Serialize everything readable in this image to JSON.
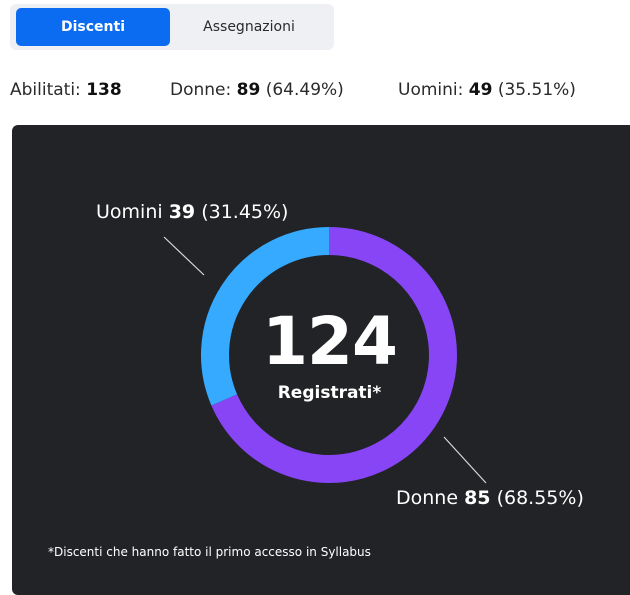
{
  "tabs": [
    {
      "label": "Discenti",
      "active": true
    },
    {
      "label": "Assegnazioni",
      "active": false
    }
  ],
  "stats": {
    "abilitati_label": "Abilitati:",
    "abilitati_value": "138",
    "donne_label": "Donne:",
    "donne_value": "89",
    "donne_pct": "(64.49%)",
    "uomini_label": "Uomini:",
    "uomini_value": "49",
    "uomini_pct": "(35.51%)"
  },
  "chart_data": {
    "type": "pie",
    "center_value": "124",
    "center_label": "Registrati*",
    "series": [
      {
        "name": "Uomini",
        "value": 39,
        "percent": "(31.45%)",
        "color": "#35aaff"
      },
      {
        "name": "Donne",
        "value": 85,
        "percent": "(68.55%)",
        "color": "#8745f5"
      }
    ]
  },
  "footnote": "*Discenti che hanno fatto il primo accesso in Syllabus",
  "colors": {
    "accent": "#0b6cf2",
    "panel_bg": "#222326"
  }
}
